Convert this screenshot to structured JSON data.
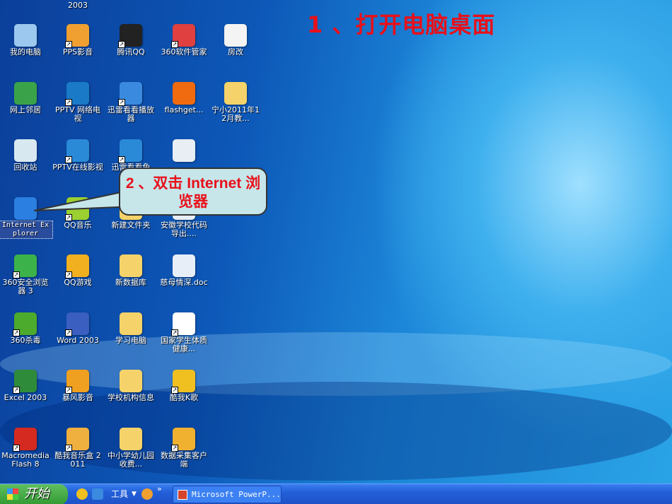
{
  "slide": {
    "title": "1 、打开电脑桌面",
    "callout": "2 、双击 Internet 浏览器"
  },
  "partial_top_label": "2003",
  "columns": [
    [
      {
        "label": "我的电脑",
        "color": "#9cc8f0"
      },
      {
        "label": "网上邻居",
        "color": "#3aa34a"
      },
      {
        "label": "回收站",
        "color": "#d8e8f0"
      },
      {
        "label": "Internet Explorer",
        "color": "#2b7fe0",
        "selected": true
      },
      {
        "label": "360安全浏览器 3",
        "color": "#3cb34a",
        "sc": true
      },
      {
        "label": "360杀毒",
        "color": "#4caa2c",
        "sc": true
      },
      {
        "label": "Excel 2003",
        "color": "#2e8b3a",
        "sc": true
      },
      {
        "label": "Macromedia Flash 8",
        "color": "#d42a20",
        "sc": true
      }
    ],
    [
      {
        "label": "PPS影音",
        "color": "#f0a030",
        "sc": true
      },
      {
        "label": "PPTV 网络电视",
        "color": "#1a7ac8",
        "sc": true
      },
      {
        "label": "PPTV在线影视",
        "color": "#2a8ad8",
        "sc": true
      },
      {
        "label": "QQ音乐",
        "color": "#9ccf30",
        "sc": true
      },
      {
        "label": "QQ游戏",
        "color": "#f0b020",
        "sc": true
      },
      {
        "label": "Word 2003",
        "color": "#3a5fc0",
        "sc": true
      },
      {
        "label": "暴风影音",
        "color": "#f0a020",
        "sc": true
      },
      {
        "label": "酷我音乐盒 2011",
        "color": "#f0b040",
        "sc": true
      }
    ],
    [
      {
        "label": "腾讯QQ",
        "color": "#222",
        "sc": true
      },
      {
        "label": "迅雷看看播放器",
        "color": "#3a8ae0",
        "sc": true
      },
      {
        "label": "迅雷看看免费...",
        "color": "#2a8ad8",
        "sc": true
      },
      {
        "label": "新建文件夹",
        "color": "#f5d36a"
      },
      {
        "label": "新数据库",
        "color": "#f5d36a"
      },
      {
        "label": "学习电脑",
        "color": "#f5d36a"
      },
      {
        "label": "学校机构信息",
        "color": "#f5d36a"
      },
      {
        "label": "中小学幼儿园收费...",
        "color": "#f5d36a"
      }
    ],
    [
      {
        "label": "360软件管家",
        "color": "#e04040",
        "sc": true
      },
      {
        "label": "flashget...",
        "color": "#f06a10"
      },
      {
        "label": "",
        "color": "#e8eef4"
      },
      {
        "label": "安徽学校代码导出....",
        "color": "#e8eef4"
      },
      {
        "label": "慈母情深.doc",
        "color": "#e8eef8"
      },
      {
        "label": "国家学生体质健康...",
        "color": "#fff",
        "sc": true
      },
      {
        "label": "酷我K歌",
        "color": "#f0c020",
        "sc": true
      },
      {
        "label": "数据采集客户端",
        "color": "#f0b030",
        "sc": true
      }
    ],
    [
      {
        "label": "房改",
        "color": "#f4f4f4"
      },
      {
        "label": "宁小2011年12月教...",
        "color": "#f5d36a"
      }
    ]
  ],
  "taskbar": {
    "start": "开始",
    "toolbar_label": "工具",
    "chevron": "»",
    "task": "Microsoft PowerP..."
  }
}
